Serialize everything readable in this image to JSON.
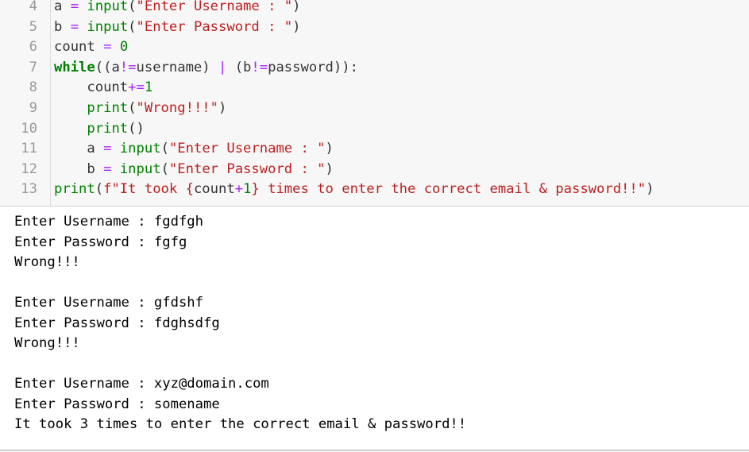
{
  "code_cell": {
    "lines": [
      {
        "num": "4",
        "tokens": [
          {
            "t": "a ",
            "c": "p"
          },
          {
            "t": "=",
            "c": "o"
          },
          {
            "t": " ",
            "c": "p"
          },
          {
            "t": "input",
            "c": "b"
          },
          {
            "t": "(",
            "c": "p"
          },
          {
            "t": "\"Enter Username : \"",
            "c": "s"
          },
          {
            "t": ")",
            "c": "p"
          }
        ]
      },
      {
        "num": "5",
        "tokens": [
          {
            "t": "b ",
            "c": "p"
          },
          {
            "t": "=",
            "c": "o"
          },
          {
            "t": " ",
            "c": "p"
          },
          {
            "t": "input",
            "c": "b"
          },
          {
            "t": "(",
            "c": "p"
          },
          {
            "t": "\"Enter Password : \"",
            "c": "s"
          },
          {
            "t": ")",
            "c": "p"
          }
        ]
      },
      {
        "num": "6",
        "tokens": [
          {
            "t": "count ",
            "c": "p"
          },
          {
            "t": "=",
            "c": "o"
          },
          {
            "t": " ",
            "c": "p"
          },
          {
            "t": "0",
            "c": "n"
          }
        ]
      },
      {
        "num": "7",
        "tokens": [
          {
            "t": "while",
            "c": "k"
          },
          {
            "t": "((a",
            "c": "p"
          },
          {
            "t": "!=",
            "c": "o"
          },
          {
            "t": "username) ",
            "c": "p"
          },
          {
            "t": "|",
            "c": "o"
          },
          {
            "t": " (b",
            "c": "p"
          },
          {
            "t": "!=",
            "c": "o"
          },
          {
            "t": "password)):",
            "c": "p"
          }
        ]
      },
      {
        "num": "8",
        "tokens": [
          {
            "t": "    count",
            "c": "p"
          },
          {
            "t": "+=",
            "c": "o"
          },
          {
            "t": "1",
            "c": "n"
          }
        ]
      },
      {
        "num": "9",
        "tokens": [
          {
            "t": "    ",
            "c": "p"
          },
          {
            "t": "print",
            "c": "b"
          },
          {
            "t": "(",
            "c": "p"
          },
          {
            "t": "\"Wrong!!!\"",
            "c": "s"
          },
          {
            "t": ")",
            "c": "p"
          }
        ]
      },
      {
        "num": "10",
        "tokens": [
          {
            "t": "    ",
            "c": "p"
          },
          {
            "t": "print",
            "c": "b"
          },
          {
            "t": "()",
            "c": "p"
          }
        ]
      },
      {
        "num": "11",
        "tokens": [
          {
            "t": "    a ",
            "c": "p"
          },
          {
            "t": "=",
            "c": "o"
          },
          {
            "t": " ",
            "c": "p"
          },
          {
            "t": "input",
            "c": "b"
          },
          {
            "t": "(",
            "c": "p"
          },
          {
            "t": "\"Enter Username : \"",
            "c": "s"
          },
          {
            "t": ")",
            "c": "p"
          }
        ]
      },
      {
        "num": "12",
        "tokens": [
          {
            "t": "    b ",
            "c": "p"
          },
          {
            "t": "=",
            "c": "o"
          },
          {
            "t": " ",
            "c": "p"
          },
          {
            "t": "input",
            "c": "b"
          },
          {
            "t": "(",
            "c": "p"
          },
          {
            "t": "\"Enter Password : \"",
            "c": "s"
          },
          {
            "t": ")",
            "c": "p"
          }
        ]
      },
      {
        "num": "13",
        "tokens": [
          {
            "t": "print",
            "c": "b"
          },
          {
            "t": "(",
            "c": "p"
          },
          {
            "t": "f\"It took {",
            "c": "s"
          },
          {
            "t": "count",
            "c": "p"
          },
          {
            "t": "+",
            "c": "o"
          },
          {
            "t": "1",
            "c": "n"
          },
          {
            "t": "} times to enter the correct email & password!!\"",
            "c": "s"
          },
          {
            "t": ")",
            "c": "p"
          }
        ]
      }
    ]
  },
  "output": {
    "lines": [
      "Enter Username : fgdfgh",
      "Enter Password : fgfg",
      "Wrong!!!",
      "",
      "Enter Username : gfdshf",
      "Enter Password : fdghsdfg",
      "Wrong!!!",
      "",
      "Enter Username : xyz@domain.com",
      "Enter Password : somename",
      "It took 3 times to enter the correct email & password!!"
    ]
  }
}
